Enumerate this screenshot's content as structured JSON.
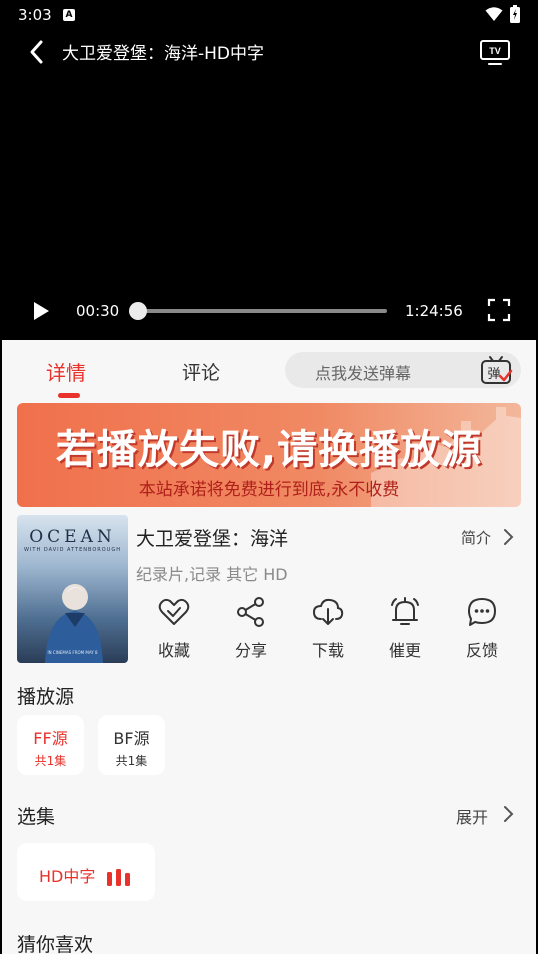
{
  "status": {
    "time": "3:03",
    "notif_letter": "A"
  },
  "header": {
    "title": "大卫爱登堡：海洋-HD中字"
  },
  "player": {
    "current_time": "00:30",
    "duration": "1:24:56",
    "progress": 0.006
  },
  "tabs": {
    "detail": "详情",
    "comment": "评论",
    "danmaku_placeholder": "点我发送弹幕",
    "danmaku_icon_label": "弹"
  },
  "banner": {
    "main": "若播放失败,请换播放源",
    "sub": "本站承诺将免费进行到底,永不收费"
  },
  "poster": {
    "title": "OCEAN",
    "subtitle": "WITH DAVID ATTENBOROUGH",
    "footer": "IN CINEMAS FROM MAY 8"
  },
  "movie": {
    "name": "大卫爱登堡：海洋",
    "intro_label": "简介",
    "meta": "纪录片,记录 其它 HD"
  },
  "actions": [
    {
      "label": "收藏",
      "icon": "heart-check-icon"
    },
    {
      "label": "分享",
      "icon": "share-icon"
    },
    {
      "label": "下载",
      "icon": "cloud-download-icon"
    },
    {
      "label": "催更",
      "icon": "bell-icon"
    },
    {
      "label": "反馈",
      "icon": "chat-bubble-icon"
    }
  ],
  "sources": {
    "title": "播放源",
    "items": [
      {
        "name": "FF源",
        "count": "共1集"
      },
      {
        "name": "BF源",
        "count": "共1集"
      }
    ]
  },
  "episodes": {
    "title": "选集",
    "expand_label": "展开",
    "items": [
      {
        "label": "HD中字"
      }
    ]
  },
  "recommend": {
    "title": "猜你喜欢"
  },
  "colors": {
    "accent": "#e8322b",
    "panel_bg": "#f7f7f7",
    "player_bg": "#000000"
  }
}
